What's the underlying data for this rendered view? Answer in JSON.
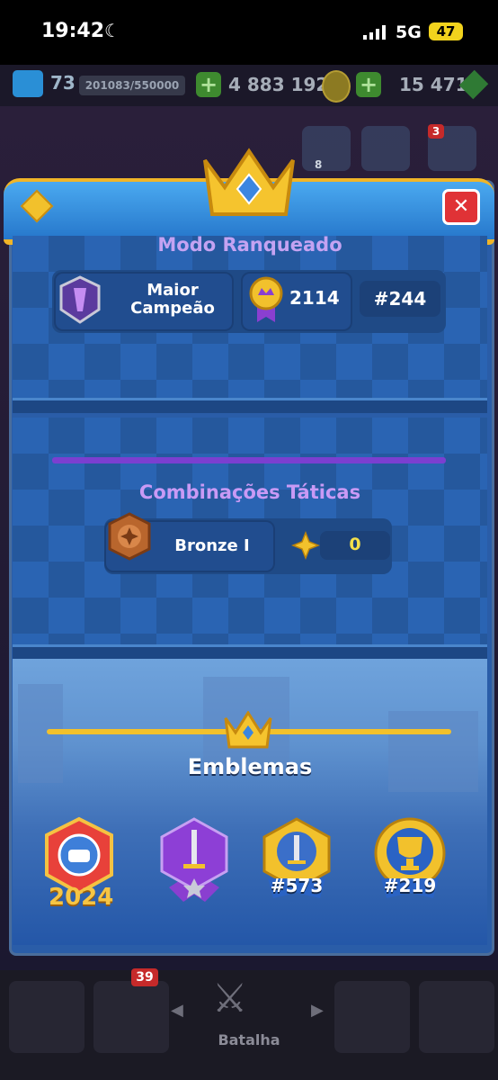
{
  "status_bar": {
    "time": "19:42",
    "network": "5G",
    "battery": "47"
  },
  "top_bar": {
    "level": "73",
    "xp": "201083/550000",
    "gold": "4 883 192",
    "gems": "15 471"
  },
  "behind": {
    "news_badge": "3",
    "friends_count": "8"
  },
  "ranked": {
    "title": "Modo Ranqueado",
    "league_label": "Maior Campeão",
    "league_line1": "Maior",
    "league_line2": "Campeão",
    "trophies": "2114",
    "rank": "#244"
  },
  "tactics": {
    "title": "Combinações Táticas",
    "league": "Bronze I",
    "points": "0"
  },
  "emblems": {
    "title": "Emblemas",
    "badges": [
      {
        "name": "season-2024-badge",
        "label": "2024"
      },
      {
        "name": "sword-purple-badge",
        "label": ""
      },
      {
        "name": "sword-gold-badge",
        "label": "#573"
      },
      {
        "name": "trophy-gold-badge",
        "label": "#219"
      }
    ]
  },
  "bottom_nav": {
    "cards_badge": "39",
    "battle_label": "Batalha"
  },
  "colors": {
    "gold": "#f2c12c",
    "panel_blue": "#2a64b3",
    "purple": "#7b3fd0",
    "close_red": "#e03236"
  }
}
